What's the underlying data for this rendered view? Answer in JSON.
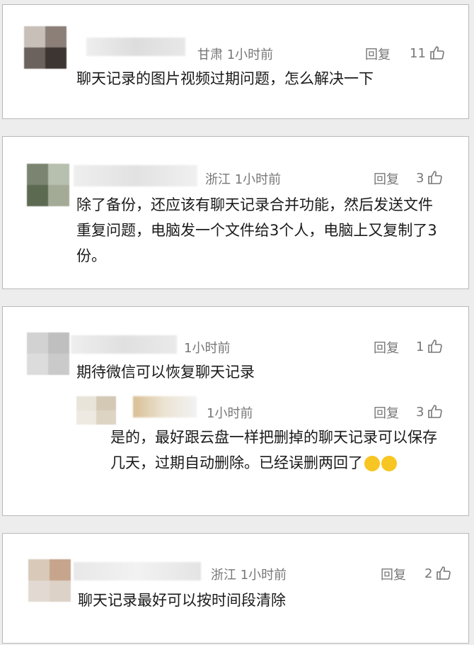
{
  "comments": [
    {
      "location": "甘肃",
      "time": "1小时前",
      "reply_label": "回复",
      "likes": "11",
      "text": "聊天记录的图片视频过期问题，怎么解决一下"
    },
    {
      "location": "浙江",
      "time": "1小时前",
      "reply_label": "回复",
      "likes": "3",
      "text": "除了备份，还应该有聊天记录合并功能，然后发送文件重复问题，电脑发一个文件给3个人，电脑上又复制了3份。"
    },
    {
      "location": "",
      "time": "1小时前",
      "reply_label": "回复",
      "likes": "1",
      "text": "期待微信可以恢复聊天记录",
      "reply": {
        "time": "1小时前",
        "reply_label": "回复",
        "likes": "3",
        "text": "是的，最好跟云盘一样把删掉的聊天记录可以保存几天，过期自动删除。已经误删两回了"
      }
    },
    {
      "location": "浙江",
      "time": "1小时前",
      "reply_label": "回复",
      "likes": "2",
      "text": "聊天记录最好可以按时间段清除"
    }
  ],
  "icons": {
    "like": "thumbs-up-icon",
    "emoji1": "crying-face-icon",
    "emoji2": "grinning-face-icon"
  }
}
